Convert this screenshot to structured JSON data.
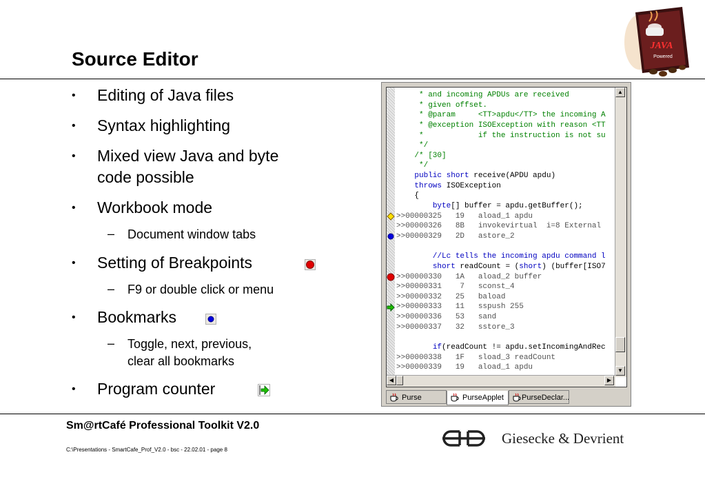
{
  "slide": {
    "title": "Source Editor",
    "bullets": [
      {
        "text": "Editing of Java files"
      },
      {
        "text": "Syntax highlighting"
      },
      {
        "text": "Mixed view Java and byte code possible",
        "line1": "Mixed view Java and byte",
        "line2": "code possible"
      },
      {
        "text": "Workbook mode",
        "sub": [
          "Document window tabs"
        ]
      },
      {
        "text": "Setting of Breakpoints",
        "icon": "breakpoint-icon",
        "sub": [
          "F9 or double click or menu"
        ]
      },
      {
        "text": "Bookmarks",
        "icon": "bookmark-icon",
        "sub": [
          "Toggle, next, previous, clear all bookmarks"
        ],
        "sub_line1": "Toggle, next, previous,",
        "sub_line2": "clear all bookmarks"
      },
      {
        "text": "Program counter",
        "icon": "program-counter-icon"
      }
    ],
    "bullet_char": "•",
    "dash_char": "–"
  },
  "editor": {
    "lines": [
      {
        "t": "     * and incoming APDUs are received",
        "c": "cm"
      },
      {
        "t": "     * given offset.",
        "c": "cm"
      },
      {
        "t": "     * @param     <TT>apdu</TT> the incoming A",
        "c": "cm"
      },
      {
        "t": "     * @exception ISOException with reason <TT",
        "c": "cm"
      },
      {
        "t": "     *            if the instruction is not su",
        "c": "cm"
      },
      {
        "t": "     */",
        "c": "cm"
      },
      {
        "t": "    /* [30]",
        "c": "cm"
      },
      {
        "t": "     */",
        "c": "cm"
      },
      {
        "t": "    public short receive(APDU apdu)",
        "c": "mix1"
      },
      {
        "t": "    throws ISOException",
        "c": "mix2"
      },
      {
        "t": "    {",
        "c": ""
      },
      {
        "t": "        byte[] buffer = apdu.getBuffer();",
        "c": "mix3"
      },
      {
        "t": ">>00000325   19   aload_1 apdu",
        "c": "bc",
        "marker": "diamond"
      },
      {
        "t": ">>00000326   8B   invokevirtual  i=8 External",
        "c": "bc"
      },
      {
        "t": ">>00000329   2D   astore_2",
        "c": "bc",
        "marker": "bookmark"
      },
      {
        "t": "",
        "c": ""
      },
      {
        "t": "        //Lc tells the incoming apdu command l",
        "c": "kw"
      },
      {
        "t": "        short readCount = (short) (buffer[ISO7",
        "c": "mix4"
      },
      {
        "t": ">>00000330   1A   aload_2 buffer",
        "c": "bc",
        "marker": "breakpoint"
      },
      {
        "t": ">>00000331    7   sconst_4",
        "c": "bc"
      },
      {
        "t": ">>00000332   25   baload",
        "c": "bc"
      },
      {
        "t": ">>00000333   11   sspush 255",
        "c": "bc",
        "marker": "pc"
      },
      {
        "t": ">>00000336   53   sand",
        "c": "bc"
      },
      {
        "t": ">>00000337   32   sstore_3",
        "c": "bc"
      },
      {
        "t": "",
        "c": ""
      },
      {
        "t": "        if(readCount != apdu.setIncomingAndRec",
        "c": "mix5"
      },
      {
        "t": ">>00000338   1F   sload_3 readCount",
        "c": "bc"
      },
      {
        "t": ">>00000339   19   aload_1 apdu",
        "c": "bc"
      }
    ],
    "tabs": [
      {
        "label": "Purse",
        "active": false
      },
      {
        "label": "PurseApplet",
        "active": true
      },
      {
        "label": "PurseDeclar...",
        "active": false
      }
    ]
  },
  "footer": {
    "title": "Sm@rtCafé Professional Toolkit V2.0",
    "path": "C:\\Presentations - SmartCafe_Prof_V2.0 - bsc - 22.02.01 - page 8",
    "company": "Giesecke & Devrient"
  },
  "logos": {
    "java_line1": "JAVA",
    "java_line2": "Powered"
  },
  "colors": {
    "breakpoint": "#e00000",
    "bookmark": "#0000e0",
    "program_counter": "#20c000",
    "comment": "#008000",
    "keyword": "#0000c0"
  }
}
